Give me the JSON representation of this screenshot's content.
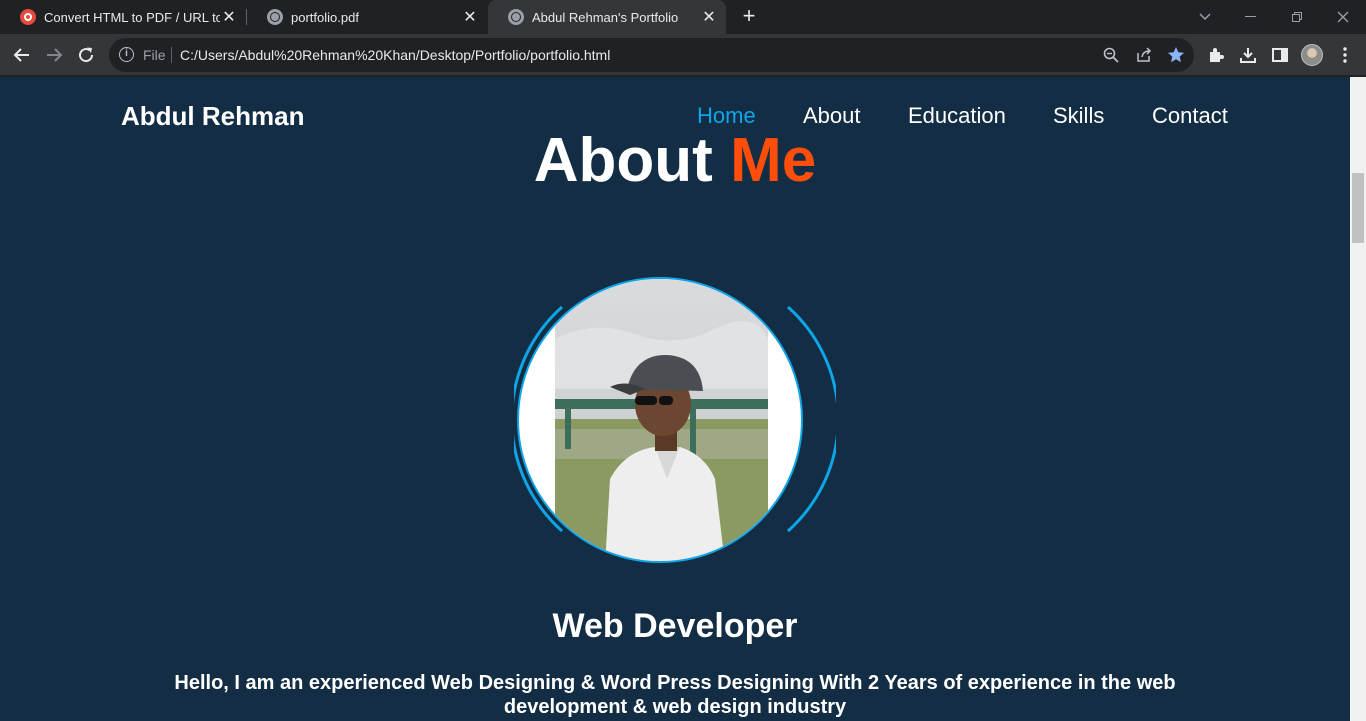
{
  "browser": {
    "tabs": [
      {
        "title": "Convert HTML to PDF / URL to PDF",
        "favicon": "pdf-converter-icon"
      },
      {
        "title": "portfolio.pdf",
        "favicon": "globe-icon"
      },
      {
        "title": "Abdul Rehman's Portfolio",
        "favicon": "globe-icon",
        "active": true
      }
    ],
    "address": {
      "scheme_label": "File",
      "url": "C:/Users/Abdul%20Rehman%20Khan/Desktop/Portfolio/portfolio.html"
    }
  },
  "page": {
    "brand": "Abdul Rehman",
    "nav": [
      "Home",
      "About",
      "Education",
      "Skills",
      "Contact"
    ],
    "active_nav": "Home",
    "about_title": {
      "main": "About",
      "accent": "Me"
    },
    "role": "Web Developer",
    "intro": "Hello, I am an experienced Web Designing & Word Press Designing With 2 Years of experience in the web development & web design industry"
  },
  "colors": {
    "page_bg": "#132d45",
    "accent_orange": "#ff4d0a",
    "accent_blue": "#0ea5e9"
  }
}
